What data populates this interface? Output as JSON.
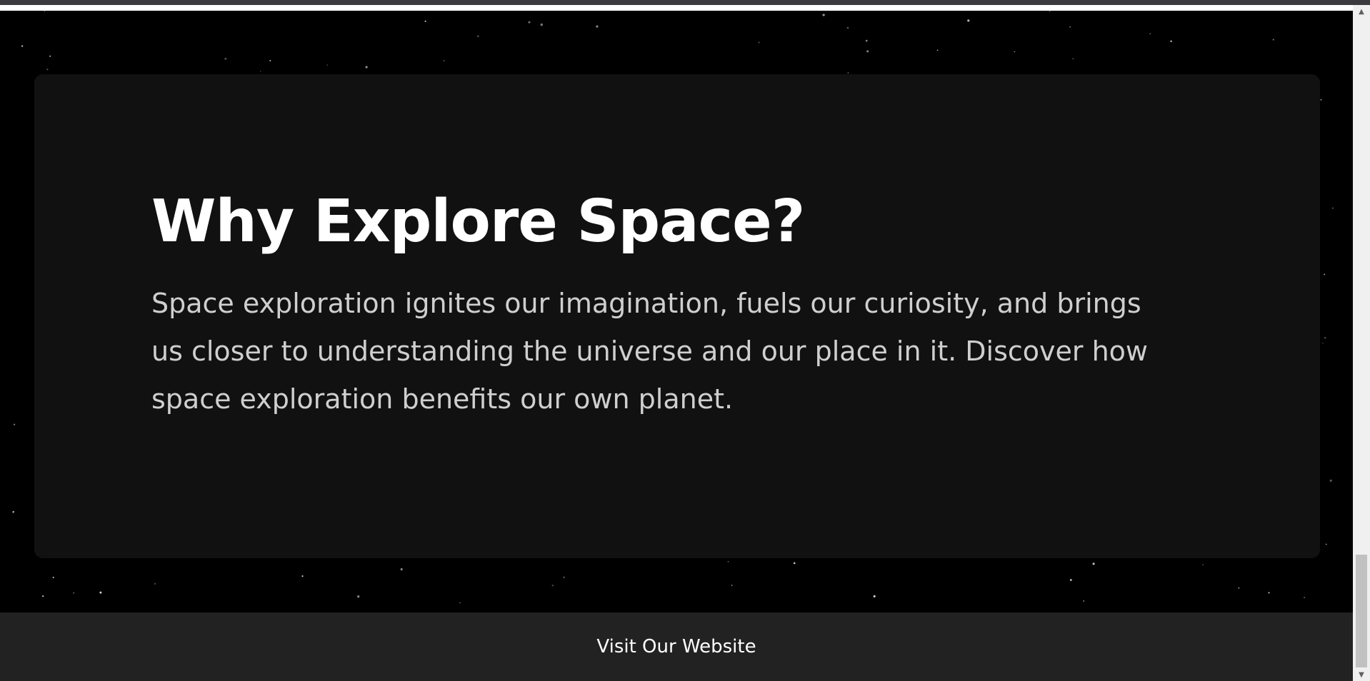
{
  "hero": {
    "title": "Why Explore Space?",
    "text": "Space exploration ignites our imagination, fuels our curiosity, and brings us closer to understanding the universe and our place in it. Discover how space exploration benefits our own planet."
  },
  "footer": {
    "link_label": "Visit Our Website"
  },
  "scrollbar": {
    "up_icon": "▲",
    "down_icon": "▼"
  },
  "colors": {
    "page_background": "#000000",
    "card_background": "#111111",
    "footer_background": "#222222",
    "title_color": "#ffffff",
    "body_text_color": "#cfcfcf"
  }
}
